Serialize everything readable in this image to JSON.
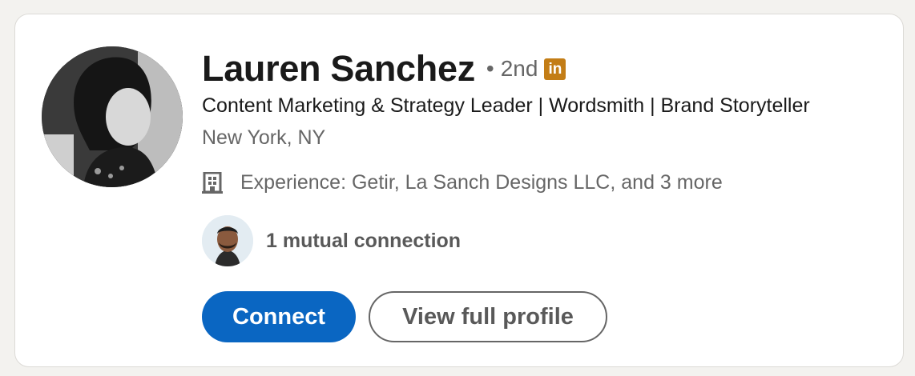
{
  "profile": {
    "name": "Lauren Sanchez",
    "separator": "•",
    "degree": "2nd",
    "badge": "in",
    "headline": "Content Marketing & Strategy Leader | Wordsmith | Brand Storyteller",
    "location": "New York, NY",
    "experience": "Experience: Getir, La Sanch Designs LLC, and 3 more",
    "mutual": "1 mutual connection"
  },
  "actions": {
    "connect_label": "Connect",
    "view_profile_label": "View full profile"
  },
  "icons": {
    "experience": "building-icon",
    "badge": "linkedin-premium-icon"
  },
  "colors": {
    "primary": "#0a66c2",
    "premium_badge": "#c37d16",
    "text_secondary": "#666666"
  }
}
